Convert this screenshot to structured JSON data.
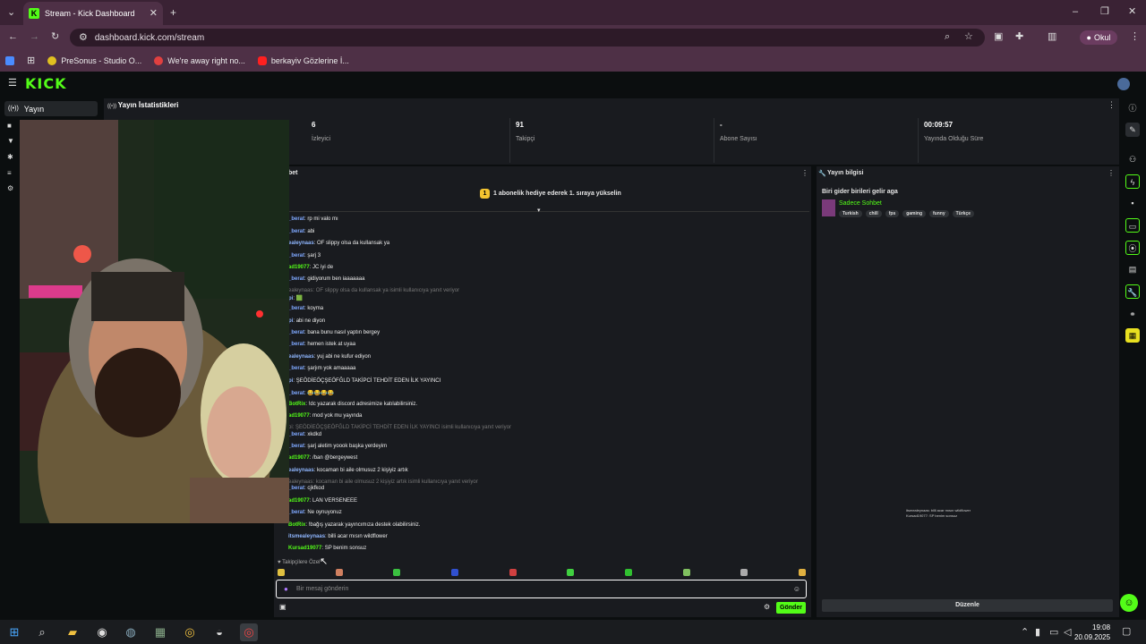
{
  "browser": {
    "tab_title": "Stream - Kick Dashboard",
    "url": "dashboard.kick.com/stream",
    "profile": "Okul",
    "bookmarks": [
      "PreSonus - Studio O...",
      "We're away right no...",
      "berkayiv Gözlerine İ..."
    ]
  },
  "kick": {
    "logo": "KICK",
    "nav_active": "Yayın"
  },
  "stats": {
    "title": "Yayın İstatistikleri",
    "items": [
      {
        "value": "6",
        "label": "İzleyici"
      },
      {
        "value": "91",
        "label": "Takipçi"
      },
      {
        "value": "-",
        "label": "Abone Sayısı"
      },
      {
        "value": "00:09:57",
        "label": "Yayında Olduğu Süre"
      }
    ]
  },
  "chat": {
    "title": "bet",
    "pinned": "1 abonelik hediye ederek 1. sıraya yükselin",
    "messages": [
      {
        "user": "_berat",
        "text": "rp mi valo mı",
        "color": "#7fa8ff"
      },
      {
        "user": "_berat",
        "text": "abi",
        "color": "#7fa8ff"
      },
      {
        "user": "ealeynaas",
        "text": "OF slippy olsa da kullansak ya",
        "color": "#8fb6ff"
      },
      {
        "user": "_berat",
        "text": "şarj 3",
        "color": "#7fa8ff"
      },
      {
        "user": "ad19077",
        "text": "JC iyi de",
        "color": "#53fc18"
      },
      {
        "user": "_berat",
        "text": "gidiyorum ben iaaaaaaa",
        "color": "#7fa8ff"
      },
      {
        "user": "",
        "text": "ealeynaas: OF slippy olsa da kullansak ya isimli kullanıcıya yanıt veriyor",
        "reply": true
      },
      {
        "user": "pi",
        "text": "🟩",
        "color": "#8fb6ff"
      },
      {
        "user": "_berat",
        "text": "koyma",
        "color": "#7fa8ff"
      },
      {
        "user": "pi",
        "text": "abi ne diyon",
        "color": "#8fb6ff"
      },
      {
        "user": "_berat",
        "text": "bana bunu nasıl yaptın bergey",
        "color": "#7fa8ff"
      },
      {
        "user": "_berat",
        "text": "hemen istek at uyaa",
        "color": "#7fa8ff"
      },
      {
        "user": "ealeynaas",
        "text": "yuj abi ne kufur ediyon",
        "color": "#8fb6ff"
      },
      {
        "user": "_berat",
        "text": "şarjım yok amaaaaa",
        "color": "#7fa8ff"
      },
      {
        "user": "pi",
        "text": "ŞEÖDİEÖÇŞEÖFĞLD TAKİPCİ TEHDİT EDEN İLK YAYINCI",
        "color": "#8fb6ff"
      },
      {
        "user": "_berat",
        "text": "😂😂😂😂",
        "color": "#7fa8ff"
      },
      {
        "user": "BotRix",
        "text": "!dc yazarak discord adresimize katılabilirsiniz.",
        "color": "#53fc18"
      },
      {
        "user": "ad19077",
        "text": "mod yok mu yayında",
        "color": "#53fc18"
      },
      {
        "user": "",
        "text": "pi: ŞEÖDİEÖÇŞEÖFĞLD TAKİPCİ TEHDİT EDEN İLK YAYINCI isimli kullanıcıya yanıt veriyor",
        "reply": true
      },
      {
        "user": "_berat",
        "text": "xkdkd",
        "color": "#7fa8ff"
      },
      {
        "user": "_berat",
        "text": "şarj aletim yoook başka yerdeyim",
        "color": "#7fa8ff"
      },
      {
        "user": "ad19077",
        "text": "/ban @bergeywest",
        "color": "#53fc18"
      },
      {
        "user": "ealeynaas",
        "text": "kocaman bi aile olmusuz 2 kişiyiz artık",
        "color": "#8fb6ff"
      },
      {
        "user": "",
        "text": "ealeynaas: kocaman bi aile olmusuz 2 kişiyiz artık isimli kullanıcıya yanıt veriyor",
        "reply": true
      },
      {
        "user": "_berat",
        "text": "cjkfkod",
        "color": "#7fa8ff"
      },
      {
        "user": "ad19077",
        "text": "LAN VERSENEEE",
        "color": "#53fc18"
      },
      {
        "user": "_berat",
        "text": "Ne oynuyonuz",
        "color": "#7fa8ff"
      },
      {
        "user": "BotRix",
        "text": "!bağış yazarak yayıncımıza destek olabilirsiniz.",
        "color": "#53fc18"
      },
      {
        "user": "itsmealeynaas",
        "text": "billi acar mısın wildflower",
        "color": "#8fb6ff"
      },
      {
        "user": "Kursad19077",
        "text": "SP benim sonsuz",
        "color": "#53fc18"
      }
    ],
    "followers_only": "Takipçilere Özel",
    "input_placeholder": "Bir mesaj gönderin",
    "send_label": "Gönder"
  },
  "info": {
    "title": "Yayın bilgisi",
    "stream_title": "Biri gider birileri gelir aga",
    "category": "Sadece Sohbet",
    "tags": [
      "Turkish",
      "chill",
      "fps",
      "gaming",
      "funny",
      "Türkçe"
    ],
    "edit_label": "Düzenle",
    "mini_chat": [
      "itsmealeynaas: billi acar mısın wildflower",
      "Kursad19077: SP benim sonsuz"
    ]
  },
  "taskbar": {
    "time": "19:08",
    "date": "20.09.2025"
  },
  "colors": {
    "accent": "#53fc18",
    "panel": "#191b1f",
    "bg": "#0b0e0f"
  }
}
